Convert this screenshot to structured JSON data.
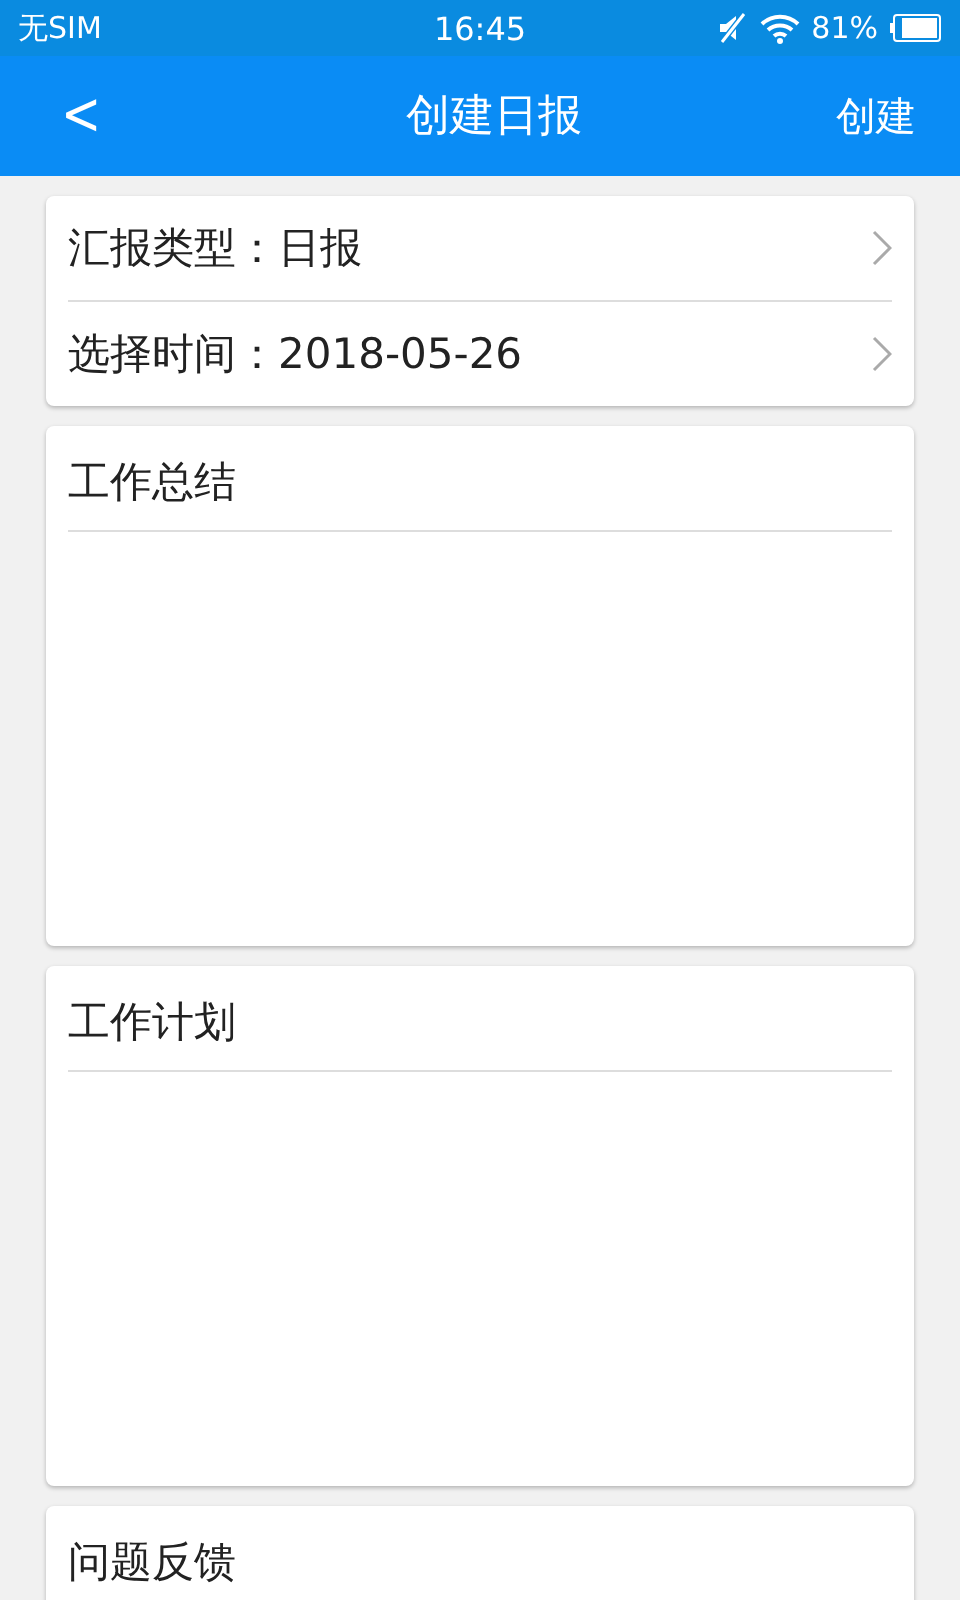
{
  "status_bar": {
    "carrier": "无SIM",
    "time": "16:45",
    "battery": "81%"
  },
  "nav_bar": {
    "back_icon": "<",
    "title": "创建日报",
    "action": "创建"
  },
  "picker_rows": [
    {
      "label": "汇报类型：日报"
    },
    {
      "label": "选择时间：2018-05-26"
    }
  ],
  "sections": [
    {
      "title": "工作总结"
    },
    {
      "title": "工作计划"
    },
    {
      "title": "问题反馈"
    }
  ]
}
